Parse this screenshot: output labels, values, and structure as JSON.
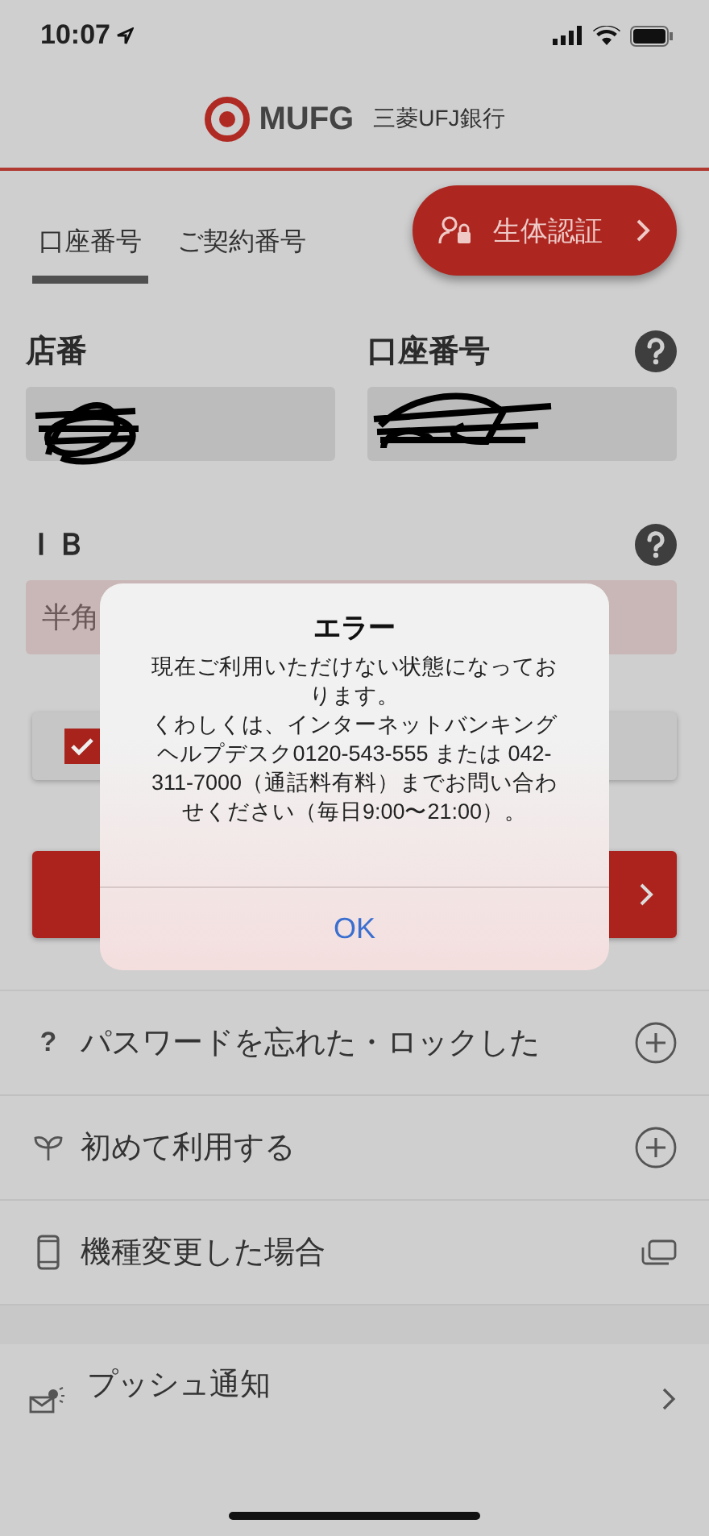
{
  "status_bar": {
    "time": "10:07"
  },
  "header": {
    "logo": "MUFG",
    "bank_name": "三菱UFJ銀行"
  },
  "tabs": [
    {
      "label": "口座番号",
      "selected": true
    },
    {
      "label": "ご契約番号",
      "selected": false
    }
  ],
  "biometric_button": {
    "label": "生体認証"
  },
  "account_fields": [
    {
      "label": "店番"
    },
    {
      "label": "口座番号",
      "help": true
    }
  ],
  "password": {
    "label": "ＩＢ",
    "placeholder": "半角",
    "help": true
  },
  "remember": {
    "checked": true
  },
  "menu": [
    {
      "label": "パスワードを忘れた・ロックした",
      "icon": "?",
      "kind": "expand"
    },
    {
      "label": "初めて利用する",
      "kind": "expand"
    },
    {
      "label": "機種変更した場合",
      "kind": "window"
    }
  ],
  "push_item": {
    "label": "プッシュ通知"
  },
  "alert": {
    "title": "エラー",
    "message": [
      "現在ご利用いただけない状態になっております。",
      "くわしくは、インターネットバンキングヘルプデスク0120-543-555 または 042-311-7000（通話料有料）までお問い合わせください（毎日9:00〜21:00）。"
    ],
    "button": "OK"
  }
}
